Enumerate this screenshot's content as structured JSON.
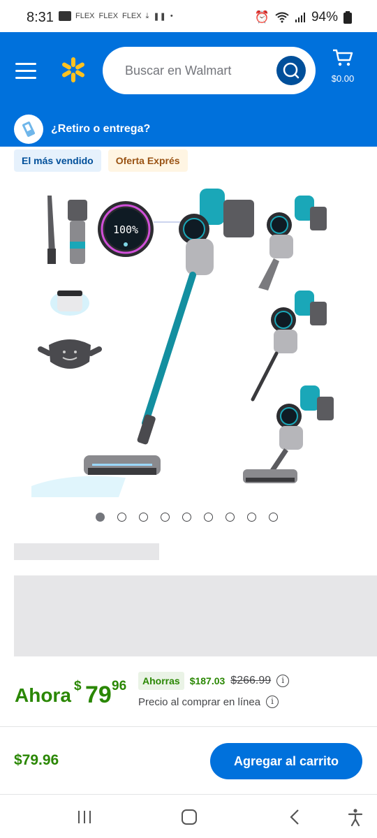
{
  "status": {
    "time": "8:31",
    "left_icons": [
      "FLEX",
      "FLEX",
      "FLEX"
    ],
    "battery": "94%"
  },
  "header": {
    "search_placeholder": "Buscar en Walmart",
    "cart_amount": "$0.00",
    "pickup_label": "¿Retiro o entrega?",
    "brand_color": "#0071dc",
    "spark_color": "#ffc220"
  },
  "badges": {
    "best_seller": "El más vendido",
    "flash_deal": "Oferta Exprés"
  },
  "gallery": {
    "image_count": 9,
    "active_index": 0,
    "display_readout": "100%"
  },
  "price": {
    "now_label": "Ahora",
    "currency": "$",
    "dollars": "79",
    "cents": "96",
    "savings_label": "Ahorras",
    "savings_amount": "$187.03",
    "was_price": "$266.99",
    "online_note": "Precio al comprar en línea",
    "info_glyph": "i"
  },
  "footer": {
    "price": "$79.96",
    "add_to_cart": "Agregar al carrito"
  }
}
